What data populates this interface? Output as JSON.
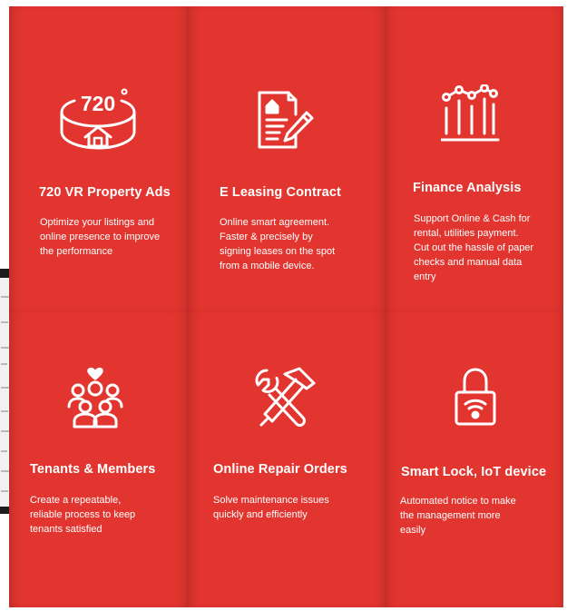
{
  "colors": {
    "card_background": "#e2352f",
    "text": "#ffffff"
  },
  "features": [
    {
      "icon": "vr-720-house-icon",
      "icon_text": "720",
      "title": "720 VR Property Ads",
      "description_lines": [
        "Optimize your listings and",
        "online presence to improve",
        "the performance"
      ]
    },
    {
      "icon": "contract-document-icon",
      "title": "E Leasing Contract",
      "description_lines": [
        "Online smart agreement.",
        "Faster & precisely by",
        "signing leases on the spot",
        "from a mobile device."
      ]
    },
    {
      "icon": "finance-chart-icon",
      "title": "Finance Analysis",
      "description_lines": [
        "Support Online & Cash for",
        "rental, utilities payment.",
        "Cut out the hassle of paper",
        "checks and manual data",
        "entry"
      ]
    },
    {
      "icon": "members-group-icon",
      "title": "Tenants & Members",
      "description_lines": [
        "Create a repeatable,",
        "reliable process to keep",
        "tenants satisfied"
      ]
    },
    {
      "icon": "repair-tools-icon",
      "title": "Online Repair Orders",
      "description_lines": [
        "Solve maintenance issues",
        "quickly and efficiently"
      ]
    },
    {
      "icon": "smart-lock-icon",
      "title": "Smart Lock,  IoT device",
      "description_lines": [
        "Automated notice to make",
        "the management more",
        "easily"
      ]
    }
  ]
}
